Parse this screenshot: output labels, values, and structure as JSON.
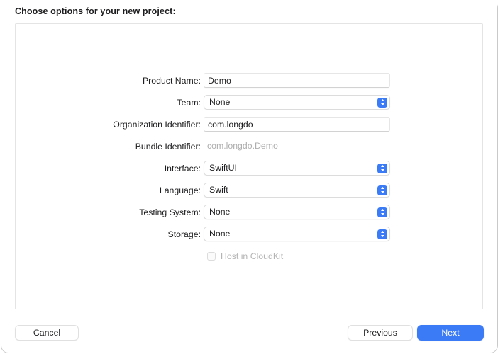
{
  "sheet": {
    "title": "Choose options for your new project:"
  },
  "form": {
    "rows": [
      {
        "label": "Product Name:",
        "type": "textfield",
        "value": "Demo",
        "placeholder": ""
      },
      {
        "label": "Team:",
        "type": "popup",
        "value": "None",
        "stepper_icon": "chevron-up-down-icon"
      },
      {
        "label": "Organization Identifier:",
        "type": "textfield",
        "value": "com.longdo",
        "placeholder": ""
      },
      {
        "label": "Bundle Identifier:",
        "type": "static",
        "value": "com.longdo.Demo"
      },
      {
        "label": "Interface:",
        "type": "popup",
        "value": "SwiftUI",
        "stepper_icon": "chevron-up-down-icon"
      },
      {
        "label": "Language:",
        "type": "popup",
        "value": "Swift",
        "stepper_icon": "chevron-up-down-icon"
      },
      {
        "label": "Testing System:",
        "type": "popup",
        "value": "None",
        "stepper_icon": "chevron-up-down-icon"
      },
      {
        "label": "Storage:",
        "type": "popup",
        "value": "None",
        "stepper_icon": "chevron-up-down-icon"
      },
      {
        "label": "",
        "type": "checkbox",
        "value": "Host in CloudKit",
        "checked": false,
        "disabled": true
      }
    ]
  },
  "footer": {
    "cancel_label": "Cancel",
    "previous_label": "Previous",
    "next_label": "Next"
  },
  "colors": {
    "accent": "#3b7bf5",
    "text": "#1d1d1f",
    "disabled_text": "#b4b4b4",
    "static_text": "#aeaeae",
    "panel_border": "#e4e4e4",
    "window_bg": "#ffffff"
  }
}
